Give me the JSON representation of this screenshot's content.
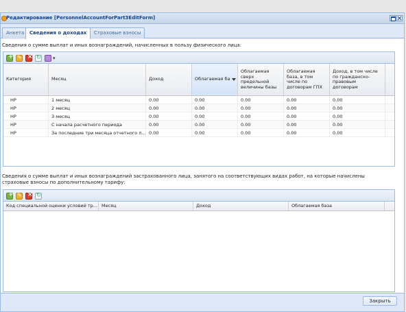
{
  "window": {
    "title": "Редактирование [PersonnelAccountForPart3EditForm]"
  },
  "tabs": [
    {
      "label": "Анкета"
    },
    {
      "label": "Сведения о доходах"
    },
    {
      "label": "Страховые взносы"
    }
  ],
  "active_tab": 1,
  "section1": {
    "description": "Сведения о сумме выплат и иных вознаграждений, начисленных в пользу физического лица:",
    "columns": [
      "Категория",
      "Месяц",
      "Доход",
      "Облагаемая база",
      "Облагаемая сверх предельной величины базы",
      "Облагаемая база, в том числе по договорам ГПХ",
      "Доход, в том числе по гражданско-правовым договорам"
    ],
    "rows": [
      [
        "НР",
        "1 месяц",
        "0.00",
        "0.00",
        "0.00",
        "0.00",
        "0.00"
      ],
      [
        "НР",
        "2 месяц",
        "0.00",
        "0.00",
        "0.00",
        "0.00",
        "0.00"
      ],
      [
        "НР",
        "3 месяц",
        "0.00",
        "0.00",
        "0.00",
        "0.00",
        "0.00"
      ],
      [
        "НР",
        "С начала расчетного периода",
        "0.00",
        "0.00",
        "0.00",
        "0.00",
        "0.00"
      ],
      [
        "НР",
        "За последние три месяца отчетного п...",
        "0.00",
        "0.00",
        "0.00",
        "0.00",
        "0.00"
      ]
    ]
  },
  "section2": {
    "description": "Сведения о сумме выплат и иных вознаграждений застрахованного лица, занятого на соответствующих видах работ, на которые начислены страховые взносы по дополнительному тарифу:",
    "columns": [
      "Код специальной оценки условий тр...",
      "Месяц",
      "Доход",
      "Облагаемая база"
    ]
  },
  "footer": {
    "close_label": "Закрыть"
  },
  "icons": [
    "add-icon",
    "edit-icon",
    "delete-icon",
    "refresh-icon",
    "menu-icon",
    "chevron-down-icon"
  ]
}
